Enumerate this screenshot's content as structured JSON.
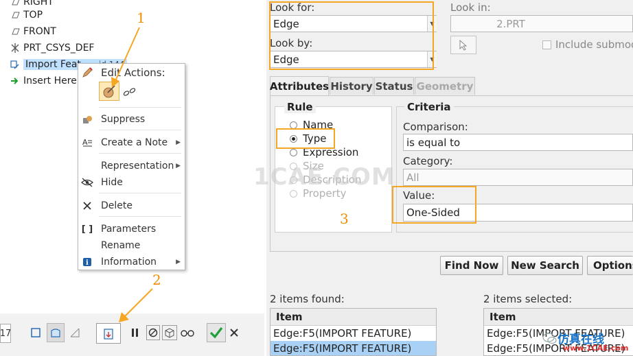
{
  "model_tree": {
    "items": [
      {
        "label": "RIGHT",
        "icon": "datum-plane-icon"
      },
      {
        "label": "TOP",
        "icon": "datum-plane-icon"
      },
      {
        "label": "FRONT",
        "icon": "datum-plane-icon"
      },
      {
        "label": "PRT_CSYS_DEF",
        "icon": "coordinate-system-icon"
      },
      {
        "label": "Import Feat",
        "suffix": "id 144",
        "icon": "import-feature-icon"
      },
      {
        "label": "Insert Here",
        "icon": "insert-arrow-icon"
      }
    ]
  },
  "context_menu": {
    "header": "Edit Actions:",
    "items": [
      {
        "label": "Suppress",
        "icon": "suppress-icon"
      },
      {
        "label": "Create a Note",
        "icon": "note-icon",
        "submenu": true
      },
      {
        "label": "Representation",
        "icon": "",
        "submenu": true
      },
      {
        "label": "Hide",
        "icon": "hide-eye-icon"
      },
      {
        "label": "Delete",
        "icon": "delete-x-icon"
      },
      {
        "label": "Parameters",
        "icon": "parameters-brackets-icon"
      },
      {
        "label": "Rename",
        "icon": ""
      },
      {
        "label": "Information",
        "icon": "info-icon",
        "submenu": true
      }
    ]
  },
  "bottom_toolbar": {
    "left_value": "17"
  },
  "search": {
    "look_for_label": "Look for:",
    "look_for_value": "Edge",
    "look_by_label": "Look by:",
    "look_by_value": "Edge",
    "look_in_label": "Look in:",
    "look_in_value": "2.PRT",
    "include_submodels": "Include submod",
    "tabs": [
      {
        "label": "Attributes",
        "state": "active"
      },
      {
        "label": "History",
        "state": "normal"
      },
      {
        "label": "Status",
        "state": "normal"
      },
      {
        "label": "Geometry",
        "state": "disabled"
      }
    ],
    "rule": {
      "title": "Rule",
      "options": [
        {
          "label": "Name",
          "selected": false,
          "enabled": true
        },
        {
          "label": "Type",
          "selected": true,
          "enabled": true
        },
        {
          "label": "Expression",
          "selected": false,
          "enabled": true
        },
        {
          "label": "Size",
          "selected": false,
          "enabled": false
        },
        {
          "label": "Description",
          "selected": false,
          "enabled": false
        },
        {
          "label": "Property",
          "selected": false,
          "enabled": false
        }
      ]
    },
    "criteria": {
      "title": "Criteria",
      "comparison_label": "Comparison:",
      "comparison_value": "is equal to",
      "category_label": "Category:",
      "category_value": "All",
      "value_label": "Value:",
      "value_value": "One-Sided"
    },
    "buttons": {
      "find_now": "Find Now",
      "new_search": "New Search",
      "options": "Options"
    },
    "found": {
      "label": "2 items found:",
      "column": "Item",
      "rows": [
        "Edge:F5(IMPORT FEATURE)",
        "Edge:F5(IMPORT FEATURE)"
      ]
    },
    "selected": {
      "label": "2 items selected:",
      "column": "Item",
      "rows": [
        "Edge:F5(IMPORT FEATURE)",
        "Edge:F5(IMPORT FEATURE)"
      ]
    }
  },
  "annotations": {
    "step1": "1",
    "step2": "2",
    "step3": "3",
    "color": "#f5a623"
  },
  "watermark": {
    "center": "1CAE.COM",
    "corner_cn": "仿真在线",
    "corner_url": "www.1CAE.com"
  }
}
